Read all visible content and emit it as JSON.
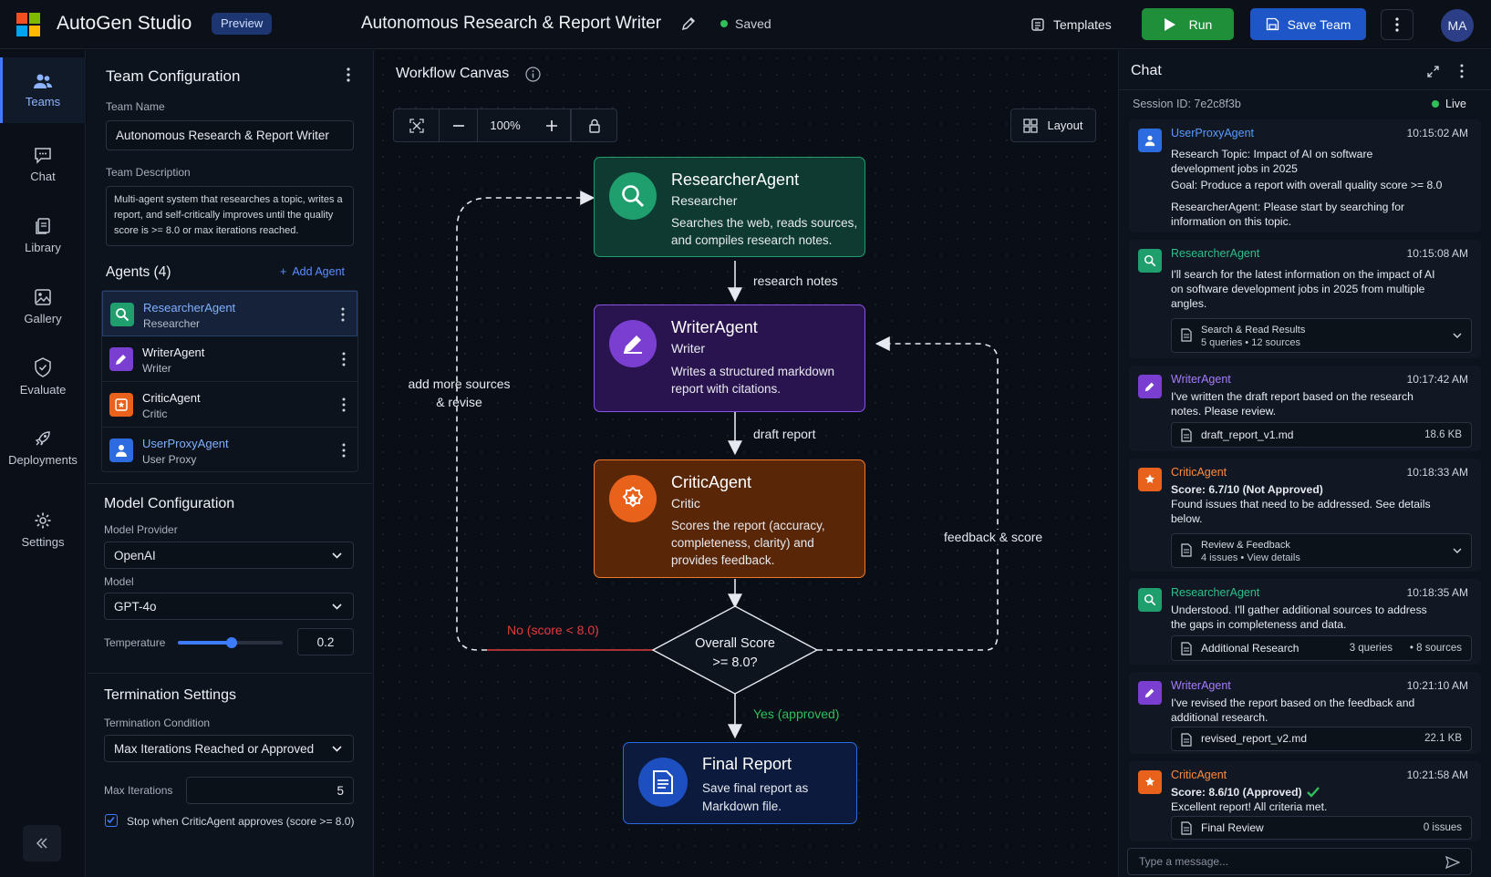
{
  "app": {
    "name": "AutoGen Studio",
    "badge": "Preview",
    "logo_colors": [
      "#f25022",
      "#7fba00",
      "#00a4ef",
      "#ffb900"
    ]
  },
  "header": {
    "project_title": "Autonomous Research & Report Writer",
    "status": "Saved",
    "templates_label": "Templates",
    "run_label": "Run",
    "save_label": "Save Team",
    "user_initials": "MA"
  },
  "nav": {
    "items": [
      {
        "label": "Teams",
        "icon": "teams-icon",
        "active": true
      },
      {
        "label": "Chat",
        "icon": "chat-icon"
      },
      {
        "label": "Library",
        "icon": "library-icon"
      },
      {
        "label": "Gallery",
        "icon": "gallery-icon"
      },
      {
        "label": "Evaluate",
        "icon": "evaluate-icon"
      },
      {
        "label": "Deployments",
        "icon": "deployments-icon"
      },
      {
        "label": "Settings",
        "icon": "gear-icon"
      }
    ]
  },
  "config": {
    "title": "Team Configuration",
    "team_name_label": "Team Name",
    "team_name": "Autonomous Research & Report Writer",
    "team_desc_label": "Team Description",
    "team_desc": "Multi-agent system that researches a topic, writes a report, and self-critically improves until the quality score is >= 8.0 or max iterations reached.",
    "agents_title": "Agents (4)",
    "add_agent": "Add Agent",
    "agents": [
      {
        "name": "ResearcherAgent",
        "role": "Researcher",
        "color": "#1f9e6e"
      },
      {
        "name": "WriterAgent",
        "role": "Writer",
        "color": "#7a3fd1"
      },
      {
        "name": "CriticAgent",
        "role": "Critic",
        "color": "#e8621c"
      },
      {
        "name": "UserProxyAgent",
        "role": "User Proxy",
        "color": "#2d6be0"
      }
    ],
    "model_title": "Model Configuration",
    "provider_label": "Model Provider",
    "provider": "OpenAI",
    "model_label": "Model",
    "model": "GPT-4o",
    "temperature_label": "Temperature",
    "temperature": "0.2",
    "termination_title": "Termination Settings",
    "condition_label": "Termination Condition",
    "condition": "Max Iterations Reached or Approved",
    "max_iter_label": "Max Iterations",
    "max_iter": "5",
    "stop_label": "Stop when CriticAgent approves (score >= 8.0)"
  },
  "canvas": {
    "title": "Workflow Canvas",
    "zoom": "100%",
    "layout_label": "Layout",
    "nodes": {
      "researcher": {
        "title": "ResearcherAgent",
        "role": "Researcher",
        "desc1": "Searches the web, reads sources,",
        "desc2": "and compiles research notes."
      },
      "writer": {
        "title": "WriterAgent",
        "role": "Writer",
        "desc1": "Writes a structured markdown",
        "desc2": "report with citations."
      },
      "critic": {
        "title": "CriticAgent",
        "role": "Critic",
        "desc1": "Scores the report (accuracy,",
        "desc2": "completeness, clarity) and",
        "desc3": "provides feedback."
      },
      "decision": {
        "line1": "Overall Score",
        "line2": ">= 8.0?"
      },
      "final": {
        "title": "Final Report",
        "desc1": "Save final report as",
        "desc2": "Markdown file."
      }
    },
    "edges": {
      "research_notes": "research notes",
      "draft_report": "draft report",
      "add_sources1": "add more sources",
      "add_sources2": "& revise",
      "feedback": "feedback & score",
      "no": "No (score < 8.0)",
      "yes": "Yes (approved)"
    }
  },
  "chat": {
    "title": "Chat",
    "session": "Session ID: 7e2c8f3b",
    "live": "Live",
    "messages": [
      {
        "agent": "UserProxyAgent",
        "time": "10:15:02 AM",
        "l1": "Research Topic: Impact of AI on software",
        "l2": "development jobs in 2025",
        "l3": "Goal: Produce a report with overall quality score >= 8.0",
        "l4": "ResearcherAgent: Please start by searching for",
        "l5": "information on this topic."
      },
      {
        "agent": "ResearcherAgent",
        "time": "10:15:08 AM",
        "l1": "I'll search for the latest information on the impact of AI",
        "l2": "on software development jobs in 2025 from multiple",
        "l3": "angles.",
        "att_title": "Search & Read Results",
        "att_sub": "5 queries • 12 sources"
      },
      {
        "agent": "WriterAgent",
        "time": "10:17:42 AM",
        "l1": "I've written the draft report based on the research",
        "l2": "notes. Please review.",
        "att_name": "draft_report_v1.md",
        "att_size": "18.6 KB"
      },
      {
        "agent": "CriticAgent",
        "time": "10:18:33 AM",
        "score": "Score: 6.7/10 (Not Approved)",
        "l1": "Found issues that need to be addressed. See details",
        "l2": "below.",
        "att_title": "Review & Feedback",
        "att_sub": "4 issues • View details"
      },
      {
        "agent": "ResearcherAgent",
        "time": "10:18:35 AM",
        "l1": "Understood. I'll gather additional sources to address",
        "l2": "the gaps in completeness and data.",
        "att_name": "Additional Research",
        "att_q": "3 queries",
        "att_s": "• 8 sources"
      },
      {
        "agent": "WriterAgent",
        "time": "10:21:10 AM",
        "l1": "I've revised the report based on the feedback and",
        "l2": "additional research.",
        "att_name": "revised_report_v2.md",
        "att_size": "22.1 KB"
      },
      {
        "agent": "CriticAgent",
        "time": "10:21:58 AM",
        "score": "Score: 8.6/10 (Approved)",
        "l1": "Excellent report! All criteria met.",
        "att_name": "Final Review",
        "att_size": "0 issues"
      }
    ],
    "placeholder": "Type a message..."
  }
}
